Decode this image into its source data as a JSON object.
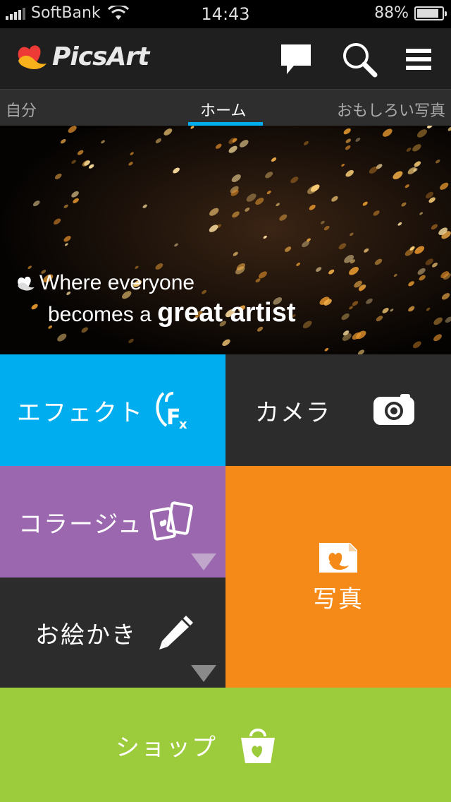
{
  "status_bar": {
    "carrier": "SoftBank",
    "time": "14:43",
    "battery_percent": "88%",
    "battery_level": 0.88
  },
  "app": {
    "name": "PicsArt",
    "icons": [
      "chat-bubble-icon",
      "search-icon",
      "menu-icon"
    ]
  },
  "tabs": [
    {
      "label": "自分",
      "active": false
    },
    {
      "label": "ホーム",
      "active": true
    },
    {
      "label": "おもしろい写真",
      "active": false
    }
  ],
  "banner": {
    "line1": "Where everyone",
    "line2_prefix": "becomes a",
    "line2_bold": "great artist"
  },
  "tiles": {
    "effects": {
      "label": "エフェクト",
      "color": "#00aeef",
      "icon": "fx-icon"
    },
    "camera": {
      "label": "カメラ",
      "color": "#2c2c2c",
      "icon": "camera-icon"
    },
    "collage": {
      "label": "コラージュ",
      "color": "#9b67ae",
      "icon": "collage-icon"
    },
    "photo": {
      "label": "写真",
      "color": "#f58a18",
      "icon": "photo-icon"
    },
    "drawing": {
      "label": "お絵かき",
      "color": "#2c2c2c",
      "icon": "pencil-icon"
    },
    "shop": {
      "label": "ショップ",
      "color": "#9ccb3b",
      "icon": "shopping-bag-icon"
    }
  }
}
